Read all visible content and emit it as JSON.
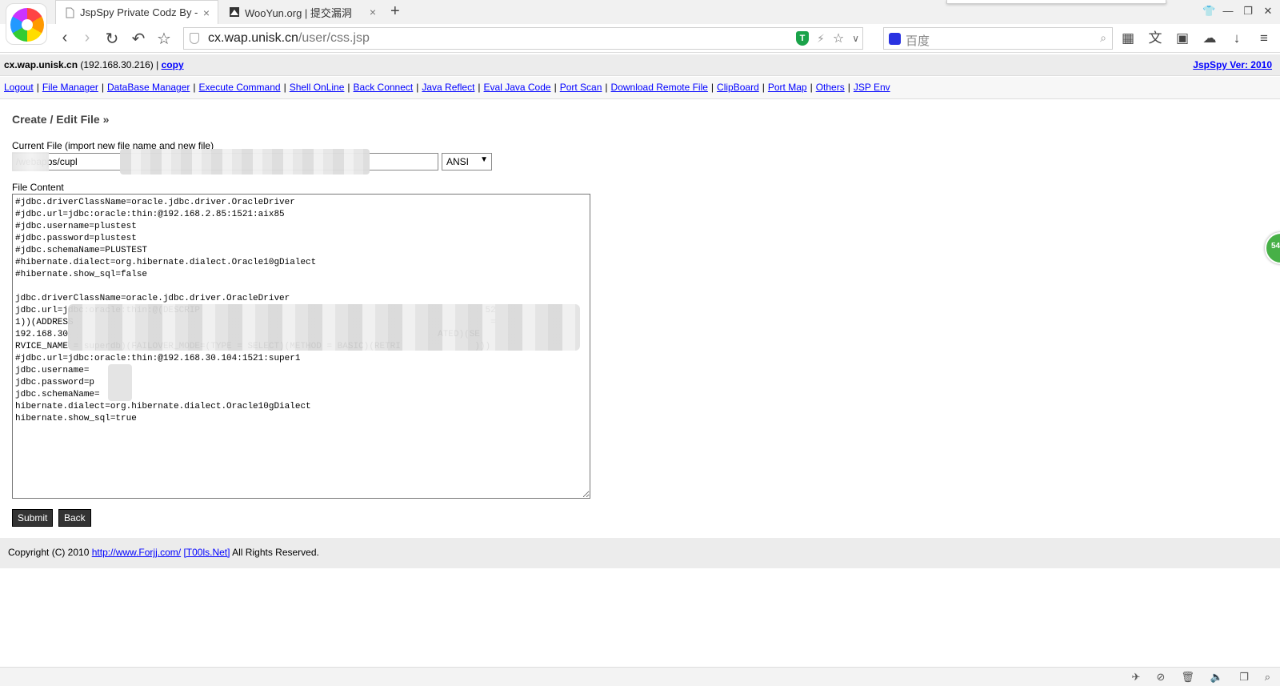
{
  "browser": {
    "tabs": [
      {
        "title": "JspSpy Private Codz By - I",
        "close": "×"
      },
      {
        "title": "WooYun.org | 提交漏洞",
        "close": "×"
      }
    ],
    "new_tab": "+",
    "url_host": "cx.wap.unisk.cn",
    "url_path": "/user/css.jsp",
    "search_placeholder": "百度",
    "window_controls": [
      "shirt-icon",
      "minimize-icon",
      "restore-icon",
      "close-icon"
    ]
  },
  "info_bar": {
    "host": "cx.wap.unisk.cn",
    "ip": "(192.168.30.216)",
    "separator": "|",
    "copy_link": "copy",
    "version": "JspSpy Ver: 2010"
  },
  "menu": {
    "items": [
      "Logout",
      "File Manager",
      "DataBase Manager",
      "Execute Command",
      "Shell OnLine",
      "Back Connect",
      "Java Reflect",
      "Eval Java Code",
      "Port Scan",
      "Download Remote File",
      "ClipBoard",
      "Port Map",
      "Others",
      "JSP Env"
    ],
    "separator": "|"
  },
  "editor": {
    "section_title": "Create / Edit File »",
    "current_file_label": "Current File (import new file name and new file)",
    "current_file_value": "/webapps/cupl",
    "encoding": "ANSI",
    "file_content_label": "File Content",
    "file_content": "#jdbc.driverClassName=oracle.jdbc.driver.OracleDriver\n#jdbc.url=jdbc:oracle:thin:@192.168.2.85:1521:aix85\n#jdbc.username=plustest\n#jdbc.password=plustest\n#jdbc.schemaName=PLUSTEST\n#hibernate.dialect=org.hibernate.dialect.Oracle10gDialect\n#hibernate.show_sql=false\n\njdbc.driverClassName=oracle.jdbc.driver.OracleDriver\njdbc.url=jdbc:oracle:thin:@(DESCRIP                                                      52\n1))(ADDRESS                                                                               =\n192.168.30                                                                      ATED)(SE\nRVICE_NAME = superdb)(FAILOVER_MODE=(TYPE = SELECT)(METHOD = BASIC)(RETRI              )))\n#jdbc.url=jdbc:oracle:thin:@192.168.30.104:1521:super1\njdbc.username=\njdbc.password=p\njdbc.schemaName=\nhibernate.dialect=org.hibernate.dialect.Oracle10gDialect\nhibernate.show_sql=true",
    "submit_label": "Submit",
    "back_label": "Back"
  },
  "footer": {
    "prefix": "Copyright (C) 2010",
    "link1": "http://www.Forjj.com/",
    "link2": "[T00ls.Net]",
    "suffix": "All Rights Reserved."
  },
  "side_bubble": "54"
}
